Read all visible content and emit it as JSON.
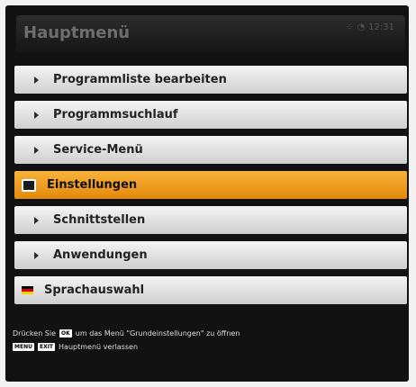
{
  "header": {
    "title": "Hauptmenü",
    "time": "12:31"
  },
  "menu": {
    "items": [
      {
        "label": "Programmliste bearbeiten",
        "icon": "arrow-right-icon"
      },
      {
        "label": "Programmsuchlauf",
        "icon": "arrow-right-icon"
      },
      {
        "label": "Service-Menü",
        "icon": "arrow-right-icon"
      },
      {
        "label": "Einstellungen",
        "icon": "tv-icon",
        "selected": true
      },
      {
        "label": "Schnittstellen",
        "icon": "arrow-right-icon"
      },
      {
        "label": "Anwendungen",
        "icon": "arrow-right-icon"
      },
      {
        "label": "Sprachauswahl",
        "icon": "german-flag-icon"
      }
    ]
  },
  "help": {
    "line1_prefix": "Drücken Sie",
    "ok_key": "OK",
    "line1_suffix": "um das Menü \"Grundeinstellungen\" zu öffnen",
    "key1": "MENU",
    "key2": "EXIT",
    "line2_suffix": "Hauptmenü verlassen"
  },
  "colors": {
    "selected": "#f0a020",
    "item": "#e6e6e6"
  }
}
